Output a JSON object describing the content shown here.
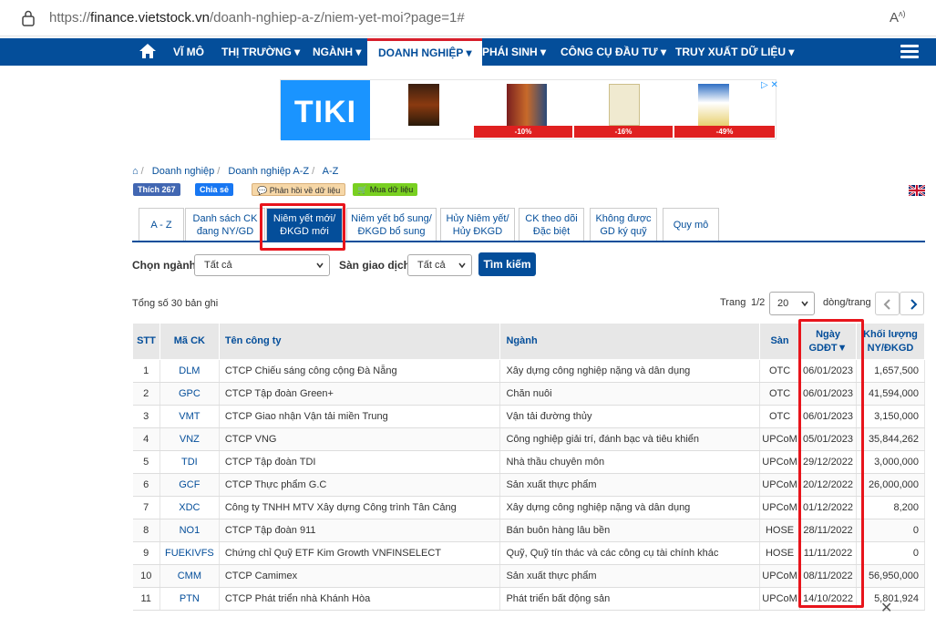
{
  "browser": {
    "url_prefix": "https://",
    "url_host": "finance.vietstock.vn",
    "url_path": "/doanh-nghiep-a-z/niem-yet-moi?page=1#",
    "read_aloud": "A"
  },
  "nav": {
    "items": [
      "VĨ MÔ",
      "THỊ TRƯỜNG ▾",
      "NGÀNH ▾",
      "DOANH NGHIỆP ▾",
      "PHÁI SINH ▾",
      "CÔNG CỤ ĐẦU TƯ ▾",
      "TRUY XUẤT DỮ LIỆU ▾"
    ],
    "active_index": 3
  },
  "banner": {
    "brand": "TIKI",
    "discounts": [
      "-10%",
      "-16%",
      "-49%"
    ]
  },
  "breadcrumb": [
    "Doanh nghiệp",
    "Doanh nghiệp A-Z",
    "A-Z"
  ],
  "social": {
    "like": "Thích 267",
    "share": "Chia sẻ",
    "feedback": "Phản hồi về dữ liệu",
    "buy": "Mua dữ liệu"
  },
  "tabs": [
    {
      "line1": "A - Z",
      "line2": ""
    },
    {
      "line1": "Danh sách CK",
      "line2": "đang NY/GD"
    },
    {
      "line1": "Niêm yết mới/",
      "line2": "ĐKGD mới"
    },
    {
      "line1": "Niêm yết bổ sung/",
      "line2": "ĐKGD bổ sung"
    },
    {
      "line1": "Hủy Niêm yết/",
      "line2": "Hủy ĐKGD"
    },
    {
      "line1": "CK theo dõi",
      "line2": "Đặc biệt"
    },
    {
      "line1": "Không được",
      "line2": "GD ký quỹ"
    },
    {
      "line1": "Quy mô",
      "line2": ""
    }
  ],
  "filters": {
    "industry_label": "Chọn ngành",
    "industry_value": "Tất cả",
    "exchange_label": "Sàn giao dịch",
    "exchange_value": "Tất cả",
    "search_button": "Tìm kiếm"
  },
  "paging": {
    "total": "Tổng số 30 bản ghi",
    "page_label": "Trang",
    "page_value": "1/2",
    "per_page": "20",
    "per_page_label": "dòng/trang"
  },
  "table": {
    "headers": [
      "STT",
      "Mã CK",
      "Tên công ty",
      "Ngành",
      "Sàn",
      "Ngày GDĐT▼",
      "Khối lượng NY/ĐKGD"
    ],
    "rows": [
      [
        "1",
        "DLM",
        "CTCP Chiếu sáng công cộng Đà Nẵng",
        "Xây dựng công nghiệp nặng và dân dụng",
        "OTC",
        "06/01/2023",
        "1,657,500"
      ],
      [
        "2",
        "GPC",
        "CTCP Tập đoàn Green+",
        "Chăn nuôi",
        "OTC",
        "06/01/2023",
        "41,594,000"
      ],
      [
        "3",
        "VMT",
        "CTCP Giao nhận Vận tải miền Trung",
        "Vận tải đường thủy",
        "OTC",
        "06/01/2023",
        "3,150,000"
      ],
      [
        "4",
        "VNZ",
        "CTCP VNG",
        "Công nghiệp giải trí, đánh bạc và tiêu khiển",
        "UPCoM",
        "05/01/2023",
        "35,844,262"
      ],
      [
        "5",
        "TDI",
        "CTCP Tập đoàn TDI",
        "Nhà thầu chuyên môn",
        "UPCoM",
        "29/12/2022",
        "3,000,000"
      ],
      [
        "6",
        "GCF",
        "CTCP Thực phẩm G.C",
        "Sản xuất thực phẩm",
        "UPCoM",
        "20/12/2022",
        "26,000,000"
      ],
      [
        "7",
        "XDC",
        "Công ty TNHH MTV Xây dựng Công trình Tân Cảng",
        "Xây dựng công nghiệp nặng và dân dụng",
        "UPCoM",
        "01/12/2022",
        "8,200"
      ],
      [
        "8",
        "NO1",
        "CTCP Tập đoàn 911",
        "Bán buôn hàng lâu bền",
        "HOSE",
        "28/11/2022",
        "0"
      ],
      [
        "9",
        "FUEKIVFS",
        "Chứng chỉ Quỹ ETF Kim Growth VNFINSELECT",
        "Quỹ, Quỹ tín thác và các công cụ tài chính khác",
        "HOSE",
        "11/11/2022",
        "0"
      ],
      [
        "10",
        "CMM",
        "CTCP Camimex",
        "Sản xuất thực phẩm",
        "UPCoM",
        "08/11/2022",
        "56,950,000"
      ],
      [
        "11",
        "PTN",
        "CTCP Phát triển nhà Khánh Hòa",
        "Phát triển bất động sản",
        "UPCoM",
        "14/10/2022",
        "5,801,924"
      ]
    ]
  }
}
